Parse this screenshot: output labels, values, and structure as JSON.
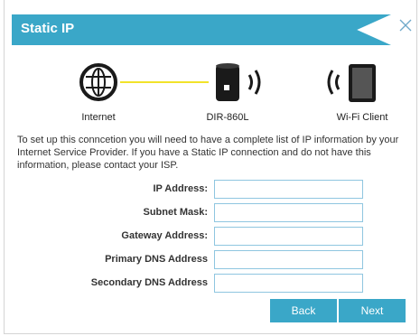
{
  "header": {
    "title": "Static IP"
  },
  "diagram": {
    "internet_label": "Internet",
    "router_label": "DIR-860L",
    "client_label": "Wi-Fi Client",
    "icons": [
      "globe-icon",
      "router-icon",
      "wifi-signal-icon",
      "tablet-icon"
    ]
  },
  "description": "To set up this conncetion you will need to have a complete list of IP information by your Internet Service Provider. If you have a Static IP connection and do not have this information, please contact your ISP.",
  "form": {
    "ip_address": {
      "label": "IP Address:",
      "value": ""
    },
    "subnet_mask": {
      "label": "Subnet Mask:",
      "value": ""
    },
    "gateway_address": {
      "label": "Gateway Address:",
      "value": ""
    },
    "primary_dns": {
      "label": "Primary DNS Address",
      "value": ""
    },
    "secondary_dns": {
      "label": "Secondary DNS Address",
      "value": ""
    }
  },
  "buttons": {
    "back": "Back",
    "next": "Next"
  },
  "colors": {
    "accent": "#3aa7c8",
    "link_line": "#f2e32a",
    "field_border": "#8fc6e0"
  }
}
